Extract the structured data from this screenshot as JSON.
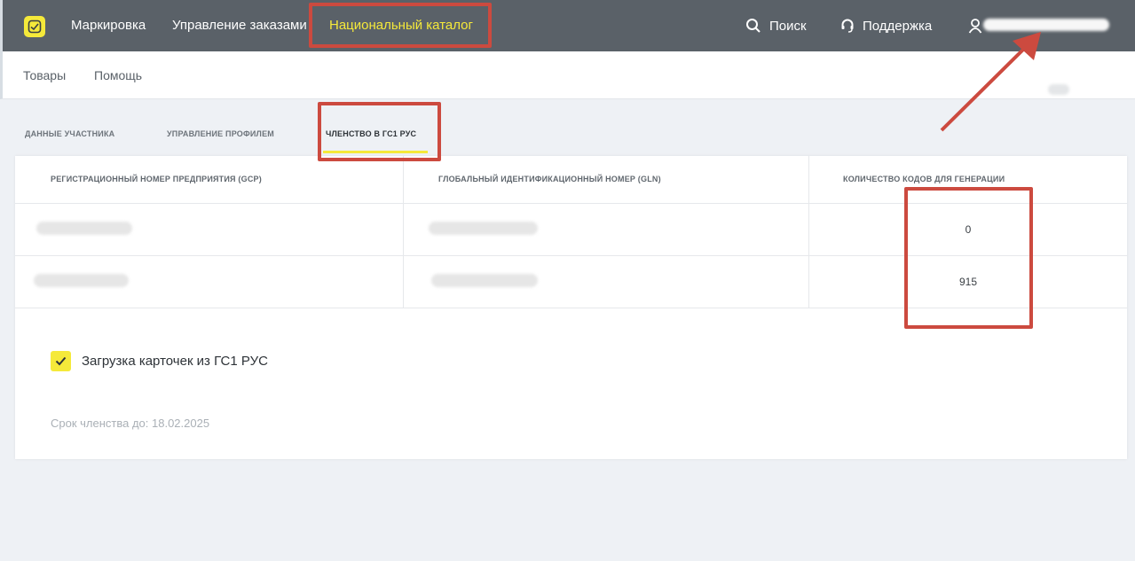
{
  "topbar": {
    "logo_icon": "marking-logo-icon",
    "nav": [
      "Маркировка",
      "Управление заказами",
      "Национальный каталог"
    ],
    "search_label": "Поиск",
    "support_label": "Поддержка",
    "user_icon": "user-icon"
  },
  "subnav": {
    "items": [
      "Товары",
      "Помощь"
    ]
  },
  "tabs": [
    "ДАННЫЕ УЧАСТНИКА",
    "УПРАВЛЕНИЕ ПРОФИЛЕМ",
    "ЧЛЕНСТВО В ГС1 РУС"
  ],
  "table": {
    "headers": [
      "РЕГИСТРАЦИОННЫЙ НОМЕР ПРЕДПРИЯТИЯ (GCP)",
      "ГЛОБАЛЬНЫЙ ИДЕНТИФИКАЦИОННЫЙ НОМЕР (GLN)",
      "КОЛИЧЕСТВО КОДОВ ДЛЯ ГЕНЕРАЦИИ"
    ],
    "rows": [
      {
        "codes": "0"
      },
      {
        "codes": "915"
      }
    ]
  },
  "checkbox_label": "Загрузка карточек из ГС1 РУС",
  "membership_text": "Срок членства до: 18.02.2025",
  "colors": {
    "accent": "#f5e93a",
    "topbar": "#5a6168",
    "annotation": "#cc4a3f"
  }
}
